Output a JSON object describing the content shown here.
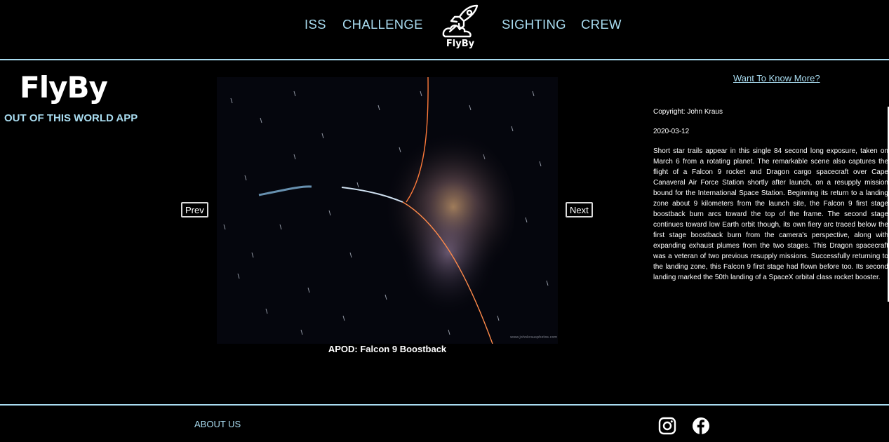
{
  "nav": {
    "left_items": [
      {
        "label": "ISS"
      },
      {
        "label": "CHALLENGE"
      }
    ],
    "right_items": [
      {
        "label": "SIGHTING"
      },
      {
        "label": "CREW"
      }
    ],
    "logo_text": "FlyBy",
    "accent_color": "#a9dcf0"
  },
  "brand": {
    "title": "FlyBy",
    "tagline": "OUT OF THIS WORLD APP"
  },
  "apod": {
    "prev_label": "Prev",
    "next_label": "Next",
    "caption": "APOD: Falcon 9 Boostback",
    "more_link": "Want To Know More?",
    "copyright": "Copyright: John Kraus",
    "date": "2020-03-12",
    "description": "Short star trails appear in this single 84 second long exposure, taken on March 6 from a rotating planet. The remarkable scene also captures the flight of a Falcon 9 rocket and Dragon cargo spacecraft over Cape Canaveral Air Force Station shortly after launch, on a resupply mission bound for the International Space Station. Beginning its return to a landing zone about 9 kilometers from the launch site, the Falcon 9 first stage boostback burn arcs toward the top of the frame. The second stage continues toward low Earth orbit though, its own fiery arc traced below the first stage boostback burn from the camera's perspective, along with expanding exhaust plumes from the two stages. This Dragon spacecraft was a veteran of two previous resupply missions. Successfully returning to the landing zone, this Falcon 9 first stage had flown before too. Its second landing marked the 50th landing of a SpaceX orbital class rocket booster."
  },
  "footer": {
    "about_label": "ABOUT US",
    "social_icons": [
      "instagram-icon",
      "facebook-icon"
    ]
  }
}
